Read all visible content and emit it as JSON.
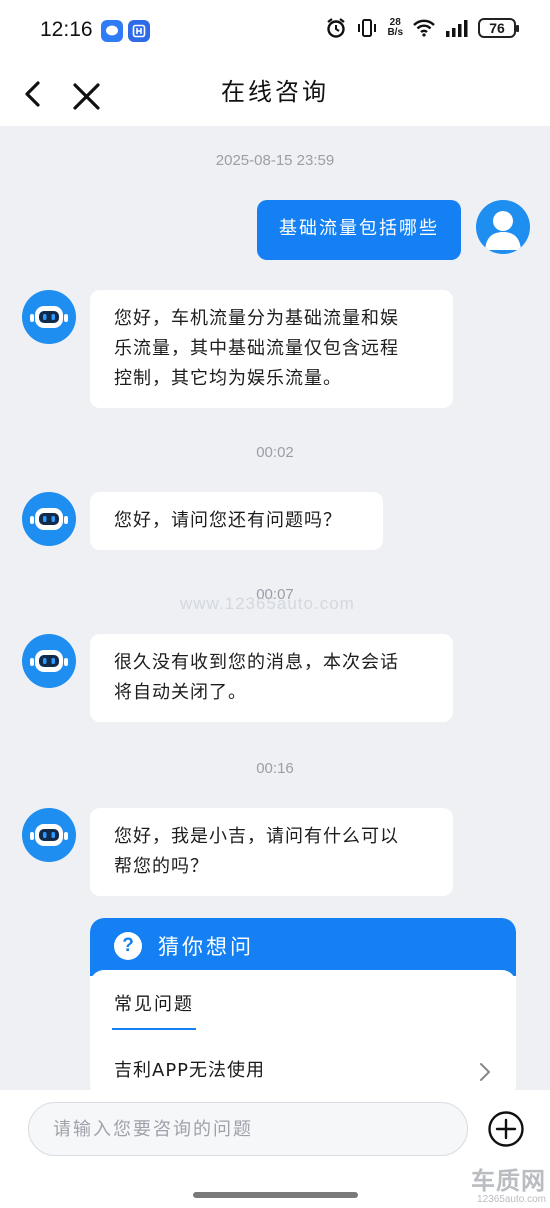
{
  "status_bar": {
    "time": "12:16",
    "net_speed_value": "28",
    "net_speed_unit": "B/s",
    "battery_level": "76",
    "icons": [
      "message-notification-icon",
      "app-notification-icon",
      "alarm-icon",
      "vibrate-icon",
      "wifi-icon",
      "signal-icon",
      "battery-icon"
    ]
  },
  "nav": {
    "title": "在线咨询",
    "back_icon": "chevron-left-icon",
    "close_icon": "close-icon"
  },
  "chat": {
    "first_timestamp": "2025-08-15 23:59",
    "user_message": "基础流量包括哪些",
    "replies": [
      {
        "line1": "您好，车机流量分为基础流量和娱",
        "line2": "乐流量，其中基础流量仅包含远程",
        "line3": "控制，其它均为娱乐流量。"
      },
      {
        "timestamp": "00:02",
        "text": "您好，请问您还有问题吗？"
      },
      {
        "timestamp": "00:07",
        "line1": "很久没有收到您的消息，本次会话",
        "line2": "将自动关闭了。"
      },
      {
        "timestamp": "00:16",
        "line1": "您好，我是小吉，请问有什么可以",
        "line2": "帮您的吗？"
      }
    ],
    "watermark": "www.12365auto.com"
  },
  "guess": {
    "icon_label": "?",
    "title": "猜你想问",
    "tab": "常见问题",
    "items": [
      "吉利APP无法使用"
    ]
  },
  "input": {
    "placeholder": "请输入您要咨询的问题",
    "add_icon": "plus-circle-icon"
  },
  "corner_logo": {
    "main": "车质网",
    "sub": "12365auto.com"
  },
  "colors": {
    "accent": "#1580f3",
    "background": "#eef0f4"
  }
}
